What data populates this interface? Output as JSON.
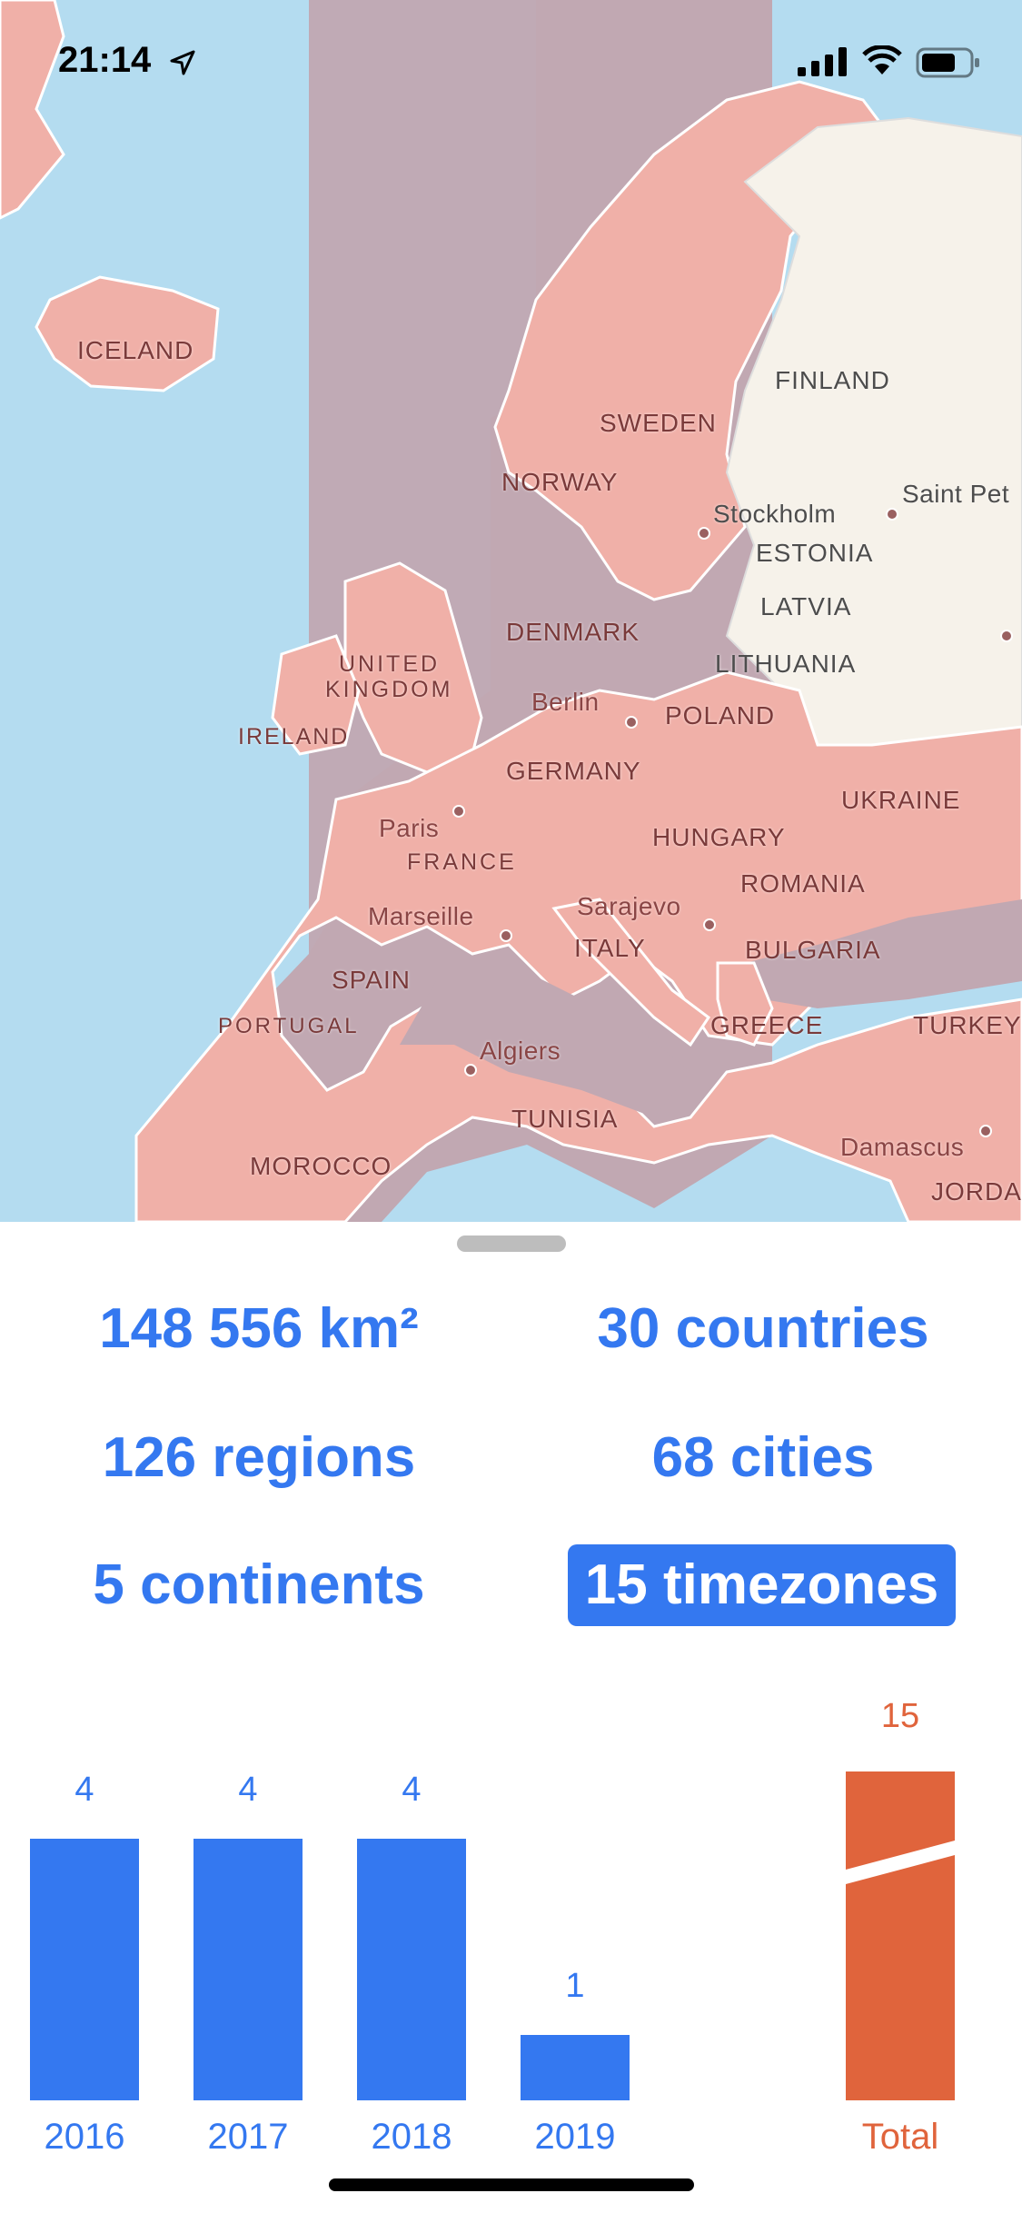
{
  "status_bar": {
    "time": "21:14"
  },
  "map": {
    "countries": [
      "ICELAND",
      "NORWAY",
      "SWEDEN",
      "FINLAND",
      "ESTONIA",
      "LATVIA",
      "LITHUANIA",
      "DENMARK",
      "UNITED",
      "KINGDOM",
      "IRELAND",
      "POLAND",
      "GERMANY",
      "FRANCE",
      "UKRAINE",
      "HUNGARY",
      "ROMANIA",
      "BULGARIA",
      "SPAIN",
      "PORTUGAL",
      "ITALY",
      "GREECE",
      "TURKEY",
      "TUNISIA",
      "MOROCCO",
      "JORDA"
    ],
    "cities": [
      "Stockholm",
      "Saint Pet",
      "Berlin",
      "Paris",
      "Marseille",
      "Sarajevo",
      "Algiers",
      "Damascus"
    ]
  },
  "stats": {
    "area": "148 556 km²",
    "countries": "30 countries",
    "regions": "126 regions",
    "cities": "68 cities",
    "continents": "5 continents",
    "timezones": "15 timezones"
  },
  "colors": {
    "accent": "#3478f0",
    "total": "#e0643c"
  },
  "chart_data": {
    "type": "bar",
    "categories": [
      "2016",
      "2017",
      "2018",
      "2019"
    ],
    "values": [
      4,
      4,
      4,
      1
    ],
    "total": {
      "label": "Total",
      "value": 15
    }
  }
}
